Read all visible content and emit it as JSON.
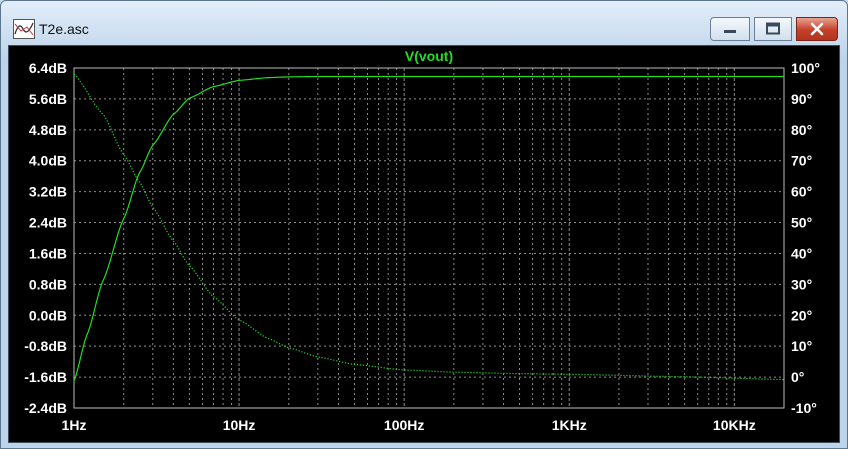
{
  "window": {
    "title": "T2e.asc",
    "controls": {
      "minimize": "minimize",
      "maximize": "maximize",
      "close": "close"
    }
  },
  "chart_data": {
    "type": "line",
    "title": "V(vout)",
    "x_scale": "log",
    "xlim": [
      1,
      20000
    ],
    "x_ticks": [
      {
        "value": 1,
        "label": "1Hz"
      },
      {
        "value": 10,
        "label": "10Hz"
      },
      {
        "value": 100,
        "label": "100Hz"
      },
      {
        "value": 1000,
        "label": "1KHz"
      },
      {
        "value": 10000,
        "label": "10KHz"
      }
    ],
    "y_left": {
      "unit": "dB",
      "lim": [
        -2.4,
        6.4
      ],
      "tick_labels": [
        "6.4dB",
        "5.6dB",
        "4.8dB",
        "4.0dB",
        "3.2dB",
        "2.4dB",
        "1.6dB",
        "0.8dB",
        "0.0dB",
        "-0.8dB",
        "-1.6dB",
        "-2.4dB"
      ]
    },
    "y_right": {
      "unit": "degrees",
      "lim": [
        -10,
        100
      ],
      "tick_labels": [
        "100°",
        "90°",
        "80°",
        "70°",
        "60°",
        "50°",
        "40°",
        "30°",
        "20°",
        "10°",
        "0°",
        "-10°"
      ]
    },
    "grid": true,
    "colors": {
      "background": "#000000",
      "grid": "#8c8c8c",
      "trace": "#22dd22",
      "title": "#22dd22",
      "labels": "#ffffff"
    },
    "series": [
      {
        "axis": "left",
        "style": "solid",
        "x": [
          1,
          1.2,
          1.5,
          2,
          2.5,
          3,
          4,
          5,
          7,
          10,
          15,
          20,
          30,
          50,
          100,
          1000,
          20000
        ],
        "y": [
          -1.7,
          -0.5,
          0.9,
          2.5,
          3.7,
          4.4,
          5.2,
          5.62,
          5.92,
          6.08,
          6.15,
          6.17,
          6.18,
          6.18,
          6.18,
          6.18,
          6.18
        ]
      },
      {
        "axis": "right",
        "style": "dotted",
        "x": [
          1,
          1.5,
          2,
          2.5,
          3,
          4,
          5,
          7,
          10,
          15,
          20,
          30,
          50,
          100,
          200,
          500,
          1000,
          5000,
          20000
        ],
        "y": [
          98,
          85,
          72,
          63,
          55,
          44,
          36,
          26,
          18.5,
          12.5,
          9.5,
          6.5,
          4.1,
          2.3,
          1.6,
          1.1,
          0.9,
          0.1,
          -0.8
        ]
      }
    ]
  }
}
